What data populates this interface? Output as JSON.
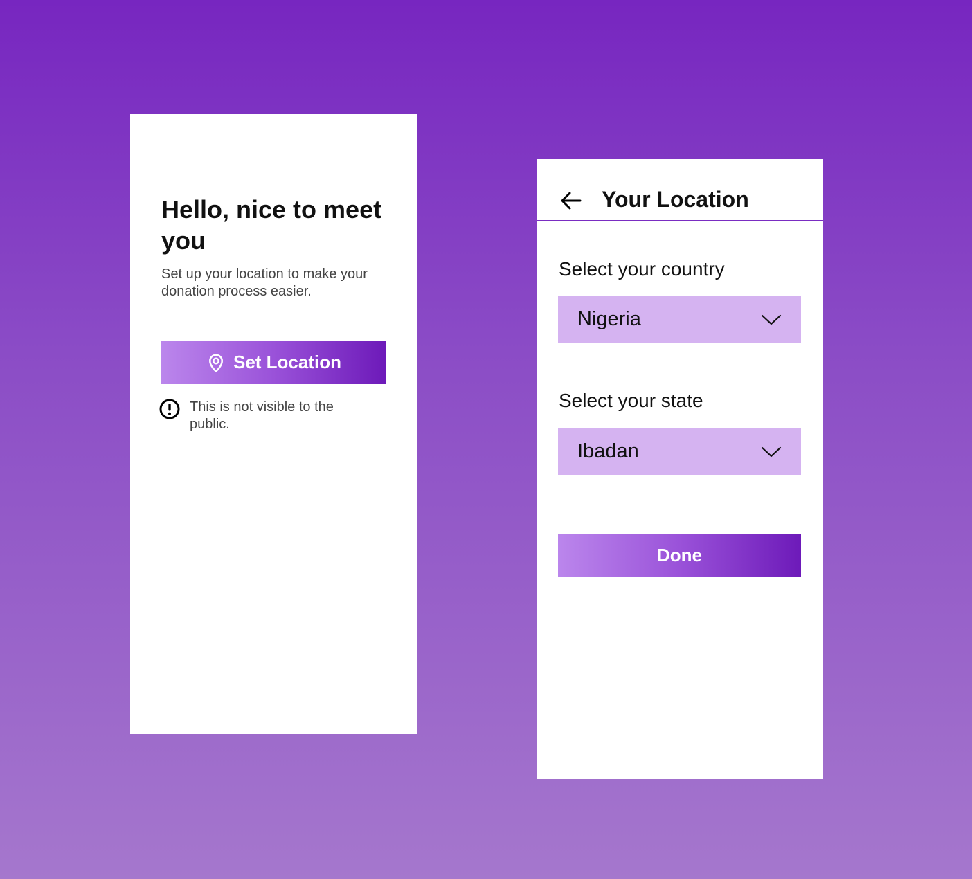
{
  "welcome_screen": {
    "heading": "Hello, nice to meet you",
    "subtext": "Set up your location to make your donation process easier.",
    "button_label": "Set Location",
    "button_icon": "location-pin-icon",
    "notice_icon": "exclamation-circle-icon",
    "notice_text": "This is not visible to the public."
  },
  "location_screen": {
    "title": "Your Location",
    "back_icon": "arrow-left-icon",
    "country_label": "Select your country",
    "country_value": "Nigeria",
    "state_label": "Select your state",
    "state_value": "Ibadan",
    "dropdown_icon": "chevron-down-icon",
    "done_label": "Done"
  },
  "colors": {
    "background_top": "#7726c0",
    "background_bottom": "#a577cd",
    "button_gradient_start": "#bb86ec",
    "button_gradient_end": "#6d1ab9",
    "select_fill": "#d5b3f1",
    "divider": "#7a2dc2"
  }
}
